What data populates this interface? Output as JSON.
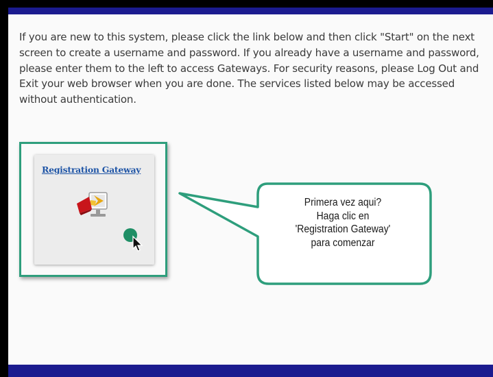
{
  "intro_text": "If you are new to this system, please click the link below and then click \"Start\" on the next screen to create a username and password. If you already have a username and password, please enter them to the left to access Gateways. For security reasons, please Log Out and Exit your web browser when you are done.  The services listed below may be accessed without authentication.",
  "card": {
    "link_label": "Registration Gateway",
    "icon": "registration-gateway-icon"
  },
  "callout": {
    "lines": [
      "Primera vez aqui?",
      "Haga clic en",
      "'Registration Gateway'",
      "para comenzar"
    ]
  },
  "colors": {
    "accent": "#2e9e7c",
    "link": "#1f55a6",
    "frame": "#1b1b8f"
  }
}
